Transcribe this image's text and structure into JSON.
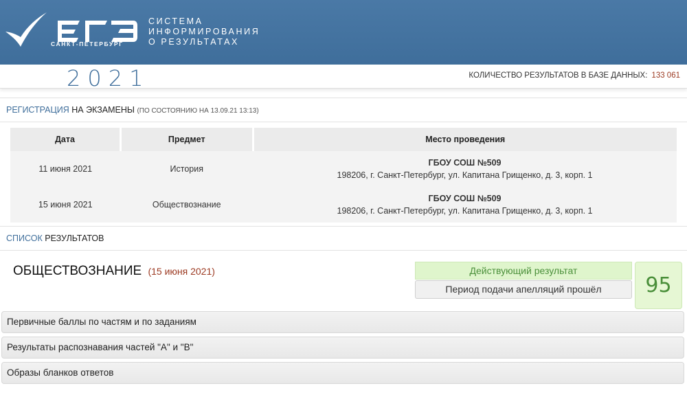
{
  "header": {
    "logo_text": "ЕГЭ",
    "logo_city": "САНКТ-ПЕТЕРБУРГ",
    "system_title": [
      "СИСТЕМА",
      "ИНФОРМИРОВАНИЯ",
      "О РЕЗУЛЬТАТАХ"
    ]
  },
  "year": "2021",
  "results_count": {
    "label": "КОЛИЧЕСТВО РЕЗУЛЬТАТОВ В БАЗЕ ДАННЫХ:",
    "value": "133 061"
  },
  "registration": {
    "title_accent": "РЕГИСТРАЦИЯ",
    "title_rest": "НА ЭКЗАМЕНЫ",
    "note": "(ПО СОСТОЯНИЮ НА 13.09.21 13:13)",
    "columns": [
      "Дата",
      "Предмет",
      "Место проведения"
    ],
    "rows": [
      {
        "date": "11 июня 2021",
        "subject": "История",
        "place_name": "ГБОУ СОШ №509",
        "place_address": "198206, г. Санкт-Петербург, ул. Капитана Грищенко, д. 3, корп. 1"
      },
      {
        "date": "15 июня 2021",
        "subject": "Обществознание",
        "place_name": "ГБОУ СОШ №509",
        "place_address": "198206, г. Санкт-Петербург, ул. Капитана Грищенко, д. 3, корп. 1"
      }
    ]
  },
  "results_list": {
    "title_accent": "СПИСОК",
    "title_rest": "РЕЗУЛЬТАТОВ"
  },
  "result": {
    "subject": "ОБЩЕСТВОЗНАНИЕ",
    "date": "(15 июня 2021)",
    "status_active": "Действующий результат",
    "status_appeal": "Период подачи апелляций прошёл",
    "score": "95"
  },
  "accordions": [
    "Первичные баллы по частям и по заданиям",
    "Результаты распознавания частей \"А\" и \"В\"",
    "Образы бланков ответов"
  ],
  "colors": {
    "header_blue": "#4a79a6",
    "accent_red": "#9c3a22",
    "success_green": "#4a8f3a"
  }
}
